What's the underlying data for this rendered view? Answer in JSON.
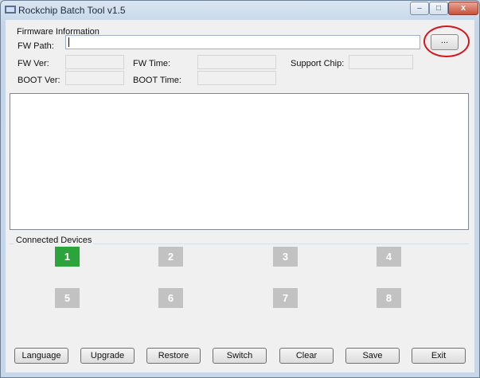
{
  "window": {
    "title": "Rockchip Batch Tool v1.5"
  },
  "caption_buttons": {
    "minimize": "–",
    "maximize": "□",
    "close": "x"
  },
  "firmware": {
    "group_title": "Firmware Information",
    "fw_path_label": "FW Path:",
    "fw_path_value": "",
    "browse_label": "...",
    "fw_ver_label": "FW Ver:",
    "fw_time_label": "FW Time:",
    "support_chip_label": "Support Chip:",
    "boot_ver_label": "BOOT Ver:",
    "boot_time_label": "BOOT Time:",
    "fw_ver_value": "",
    "fw_time_value": "",
    "support_chip_value": "",
    "boot_ver_value": "",
    "boot_time_value": ""
  },
  "log": {
    "text": ""
  },
  "devices": {
    "group_title": "Connected Devices",
    "slots": [
      {
        "label": "1",
        "active": true
      },
      {
        "label": "2",
        "active": false
      },
      {
        "label": "3",
        "active": false
      },
      {
        "label": "4",
        "active": false
      },
      {
        "label": "5",
        "active": false
      },
      {
        "label": "6",
        "active": false
      },
      {
        "label": "7",
        "active": false
      },
      {
        "label": "8",
        "active": false
      }
    ],
    "active_color": "#2ba53b",
    "inactive_color": "#c2c2c2"
  },
  "buttons": {
    "language": "Language",
    "upgrade": "Upgrade",
    "restore": "Restore",
    "switch": "Switch",
    "clear": "Clear",
    "save": "Save",
    "exit": "Exit"
  },
  "annotation": {
    "color": "#d8141b"
  }
}
